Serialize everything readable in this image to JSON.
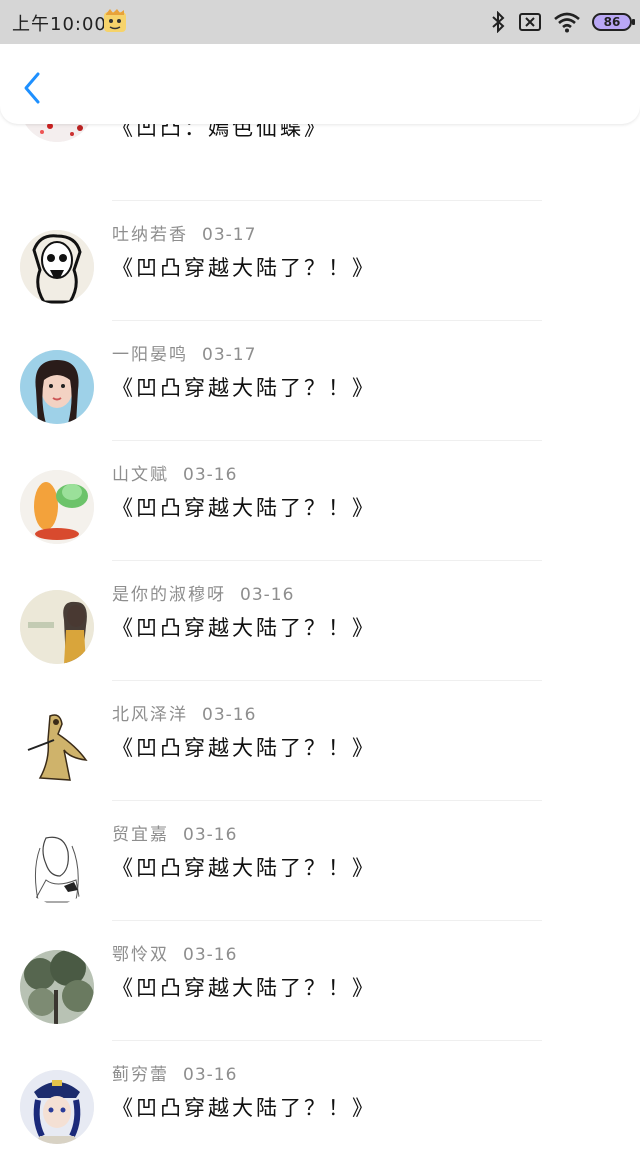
{
  "status_bar": {
    "time": "上午10:00",
    "battery": "86"
  },
  "nav": {
    "back_icon": "chevron-left-icon"
  },
  "comments": [
    {
      "user": "",
      "date": "",
      "text": "《凹凸：嫣色仙蝶》"
    },
    {
      "user": "吐纳若香",
      "date": "03-17",
      "text": "《凹凸穿越大陆了？！》"
    },
    {
      "user": "一阳晏鸣",
      "date": "03-17",
      "text": "《凹凸穿越大陆了？！》"
    },
    {
      "user": "山文赋",
      "date": "03-16",
      "text": "《凹凸穿越大陆了？！》"
    },
    {
      "user": "是你的淑穆呀",
      "date": "03-16",
      "text": "《凹凸穿越大陆了？！》"
    },
    {
      "user": "北风泽洋",
      "date": "03-16",
      "text": "《凹凸穿越大陆了？！》"
    },
    {
      "user": "贸宜嘉",
      "date": "03-16",
      "text": "《凹凸穿越大陆了？！》"
    },
    {
      "user": "鄂怜双",
      "date": "03-16",
      "text": "《凹凸穿越大陆了？！》"
    },
    {
      "user": "蓟穷蕾",
      "date": "03-16",
      "text": "《凹凸穿越大陆了？！》"
    }
  ]
}
